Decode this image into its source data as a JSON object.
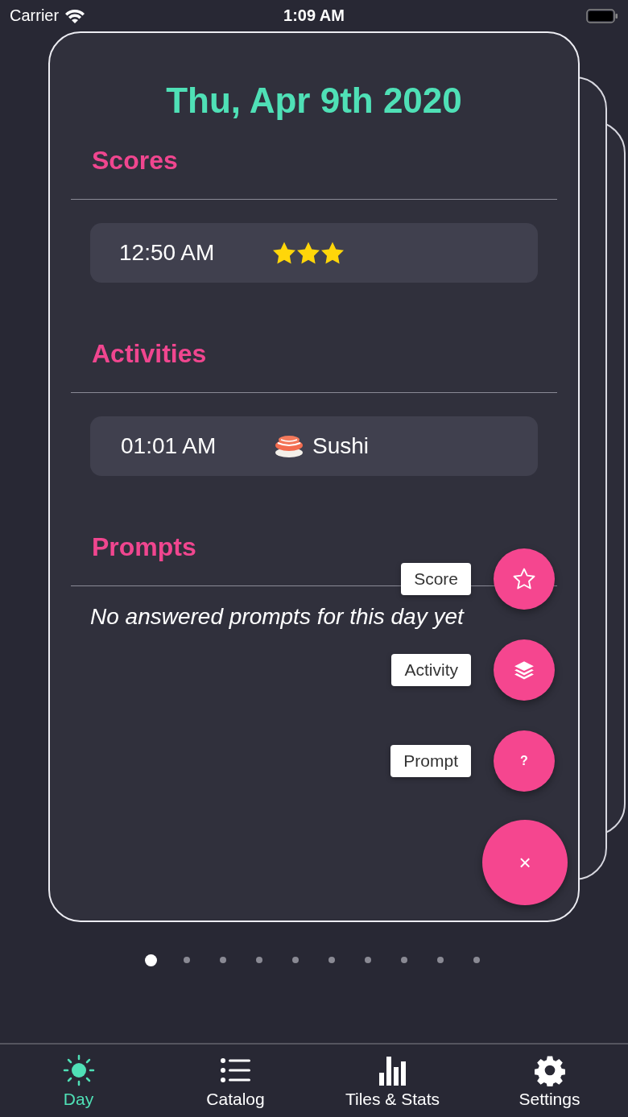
{
  "status_bar": {
    "carrier": "Carrier",
    "time": "1:09 AM"
  },
  "day": {
    "title": "Thu, Apr 9th 2020",
    "sections": [
      {
        "kind": "scores",
        "heading": "Scores",
        "entries": [
          {
            "time": "12:50 AM",
            "stars": 3
          }
        ]
      },
      {
        "kind": "activities",
        "heading": "Activities",
        "entries": [
          {
            "time": "01:01 AM",
            "name": "Sushi"
          }
        ]
      },
      {
        "kind": "prompts",
        "heading": "Prompts",
        "empty_text": "No answered prompts for this day yet"
      }
    ]
  },
  "fab_menu": {
    "actions": [
      {
        "kind": "score",
        "label": "Score"
      },
      {
        "kind": "activity",
        "label": "Activity"
      },
      {
        "kind": "prompt",
        "label": "Prompt",
        "glyph": "?"
      }
    ],
    "close_glyph": "×"
  },
  "page_dots": [
    {
      "selected": true
    },
    {
      "selected": false
    },
    {
      "selected": false
    },
    {
      "selected": false
    },
    {
      "selected": false
    },
    {
      "selected": false
    },
    {
      "selected": false
    },
    {
      "selected": false
    },
    {
      "selected": false
    },
    {
      "selected": false
    }
  ],
  "tabs": [
    {
      "kind": "day",
      "label": "Day",
      "selected": true
    },
    {
      "kind": "catalog",
      "label": "Catalog",
      "selected": false
    },
    {
      "kind": "stats",
      "label": "Tiles & Stats",
      "selected": false
    },
    {
      "kind": "settings",
      "label": "Settings",
      "selected": false
    }
  ]
}
